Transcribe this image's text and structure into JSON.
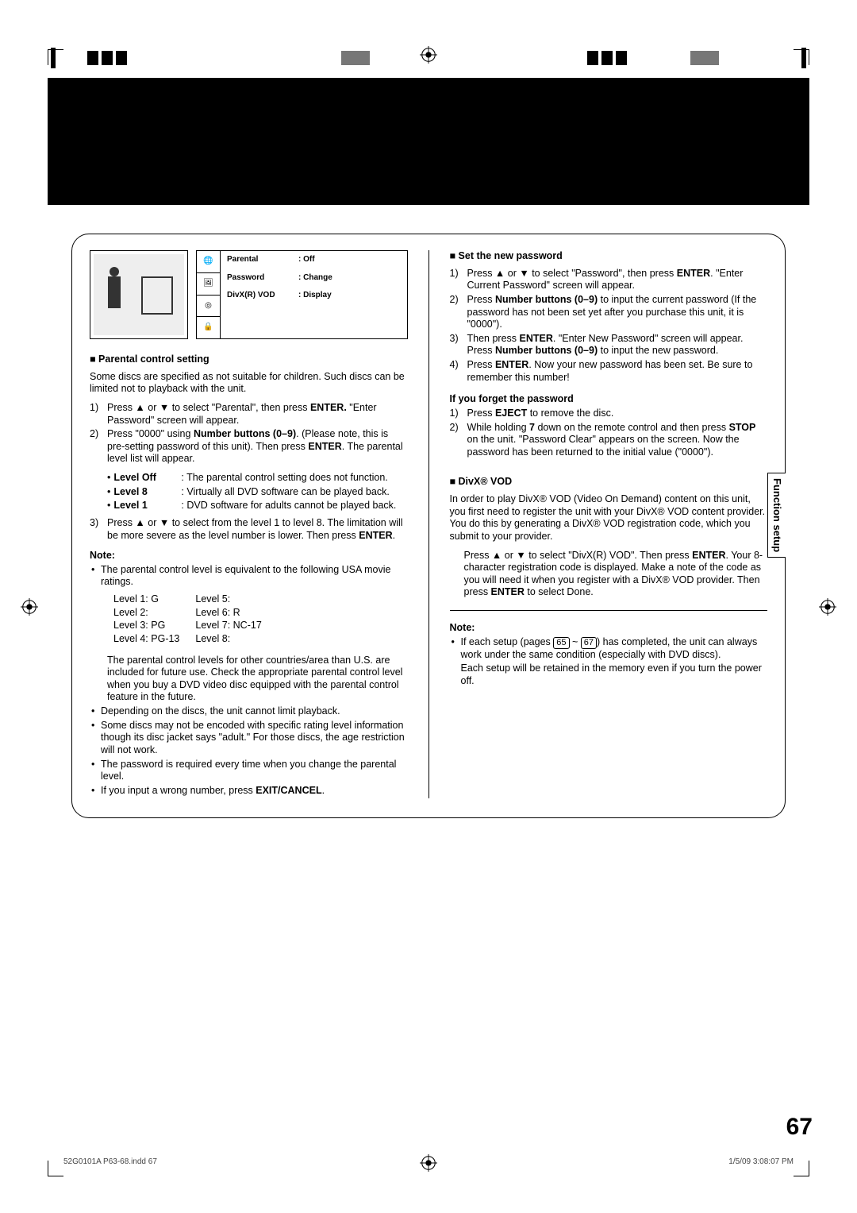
{
  "osd": {
    "rows": [
      {
        "k": "Parental",
        "v": ": Off"
      },
      {
        "k": "Password",
        "v": ": Change"
      },
      {
        "k": "DivX(R) VOD",
        "v": ": Display"
      }
    ],
    "icons": [
      "globe-abc-icon",
      "picture-icon",
      "disc-icon",
      "lock-icon"
    ]
  },
  "sidetab": "Function setup",
  "left": {
    "h1": "Parental control setting",
    "intro": "Some discs are specified as not suitable for children. Such discs can be limited not to playback with the unit.",
    "s1a": "Press ▲ or ▼ to select \"Parental\", then press ",
    "s1b": "ENTER.",
    "s1c": " \"Enter Password\" screen will appear.",
    "s2a": "Press \"0000\" using ",
    "s2b": "Number buttons (0–9)",
    "s2c": ". (Please note, this is pre-setting password of this unit). Then press ",
    "s2d": "ENTER",
    "s2e": ". The parental level list will appear.",
    "lvOffK": "Level Off",
    "lvOffV": ": The parental control setting does not function.",
    "lv8K": "Level 8",
    "lv8V": ": Virtually all DVD software can be played back.",
    "lv1K": "Level 1",
    "lv1V": ": DVD software for adults cannot be played back.",
    "s3a": "Press ▲ or ▼ to select from the level 1 to level 8. The limitation will be more severe as the level number is lower. Then press ",
    "s3b": "ENTER",
    "s3c": ".",
    "note": "Note:",
    "n1": "The parental control level is equivalent to the following USA movie ratings.",
    "ratingsL": [
      "Level 1: G",
      "Level 2:",
      "Level 3: PG",
      "Level 4: PG-13"
    ],
    "ratingsR": [
      "Level 5:",
      "Level 6: R",
      "Level 7: NC-17",
      "Level 8:"
    ],
    "n2": "The parental control levels for other countries/area than U.S. are included for future use. Check the appropriate parental control level when you buy a DVD video disc equipped with the parental control feature in the future.",
    "n3": "Depending on the discs, the unit cannot limit playback.",
    "n4": "Some discs may not be encoded with specific rating level information though its disc jacket says \"adult.\" For those discs, the age restriction will not work.",
    "n5": "The password is required every time when you change the parental level.",
    "n6a": "If you input a wrong number, press ",
    "n6b": "EXIT/CANCEL",
    "n6c": "."
  },
  "right": {
    "h1": "Set the new password",
    "p1a": "Press ▲ or ▼ to select \"Password\", then press ",
    "p1b": "ENTER",
    "p1c": ". \"Enter Current Password\" screen will appear.",
    "p2a": "Press ",
    "p2b": "Number buttons (0–9)",
    "p2c": " to input the current password (If the password has not been set yet after you purchase this unit, it is \"0000\").",
    "p3a": "Then press ",
    "p3b": "ENTER",
    "p3c": ". \"Enter New Password\" screen will appear. Press ",
    "p3d": "Number buttons (0–9)",
    "p3e": " to input the new password.",
    "p4a": "Press ",
    "p4b": "ENTER",
    "p4c": ". Now your new password has been set. Be sure to remember this number!",
    "h2": "If you forget the password",
    "f1a": "Press ",
    "f1b": "EJECT",
    "f1c": " to remove the disc.",
    "f2a": "While holding ",
    "f2b": "7",
    "f2c": " down on the remote control and then press ",
    "f2d": "STOP",
    "f2e": " on the unit. \"Password Clear\" appears on the screen. Now the password has been returned to the initial value (\"0000\").",
    "h3": "DivX® VOD",
    "d1": "In order to play DivX® VOD (Video On Demand) content on this unit, you first need to register the unit with your DivX® VOD content provider. You do this by generating a DivX® VOD registration code, which you submit to your provider.",
    "d2a": "Press ▲ or ▼ to select \"DivX(R) VOD\". Then press ",
    "d2b": "ENTER",
    "d2c": ". Your 8-character registration code is displayed. Make a note of the code as you will need it when you register with a DivX® VOD provider. Then press ",
    "d2d": "ENTER",
    "d2e": " to select Done.",
    "note": "Note:",
    "bn1a": "If each setup (pages ",
    "bn1p1": "65",
    "bn1mid": " ~ ",
    "bn1p2": "67",
    "bn1b": ") has completed, the unit can always work under the same condition (especially with DVD discs).",
    "bn2": "Each setup will be retained in the memory even if you turn the power off."
  },
  "pagenum": "67",
  "footer": {
    "l": "52G0101A P63-68.indd   67",
    "r": "1/5/09   3:08:07 PM"
  }
}
